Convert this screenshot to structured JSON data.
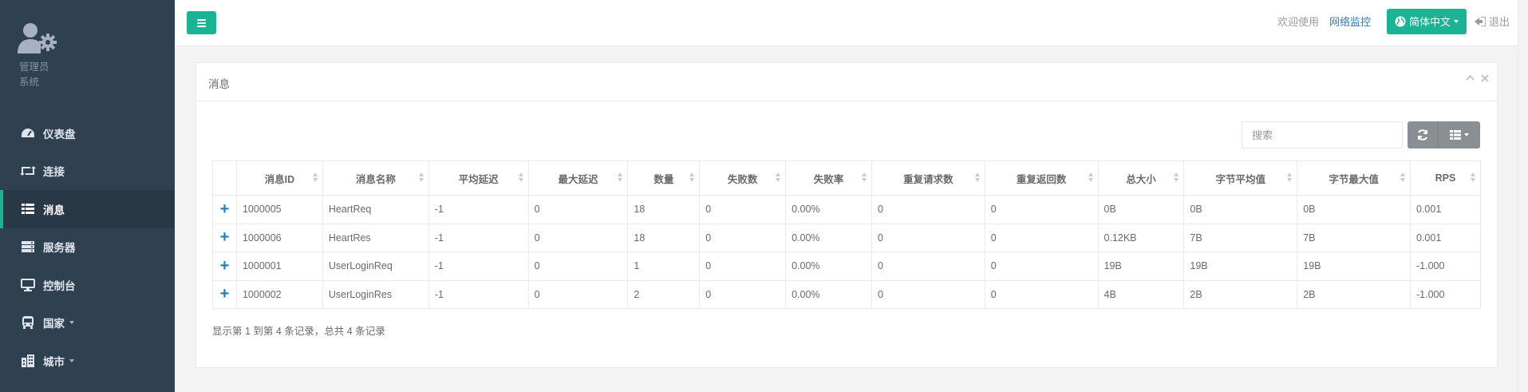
{
  "user": {
    "name": "管理员",
    "role": "系统"
  },
  "nav": [
    {
      "label": "仪表盘",
      "icon": "dashboard-icon",
      "active": false,
      "dropdown": false
    },
    {
      "label": "连接",
      "icon": "retweet-icon",
      "active": false,
      "dropdown": false
    },
    {
      "label": "消息",
      "icon": "table-icon",
      "active": true,
      "dropdown": false
    },
    {
      "label": "服务器",
      "icon": "server-icon",
      "active": false,
      "dropdown": false
    },
    {
      "label": "控制台",
      "icon": "desktop-icon",
      "active": false,
      "dropdown": false
    },
    {
      "label": "国家",
      "icon": "bus-icon",
      "active": false,
      "dropdown": true
    },
    {
      "label": "城市",
      "icon": "building-icon",
      "active": false,
      "dropdown": true
    }
  ],
  "topbar": {
    "welcome": "欢迎使用",
    "monitor_link": "网络监控",
    "language": "简体中文",
    "logout": "退出"
  },
  "panel": {
    "title": "消息",
    "search_placeholder": "搜索"
  },
  "table": {
    "columns": [
      "消息ID",
      "消息名称",
      "平均延迟",
      "最大延迟",
      "数量",
      "失败数",
      "失败率",
      "重复请求数",
      "重复返回数",
      "总大小",
      "字节平均值",
      "字节最大值",
      "RPS"
    ],
    "rows": [
      [
        "1000005",
        "HeartReq",
        "-1",
        "0",
        "18",
        "0",
        "0.00%",
        "0",
        "0",
        "0B",
        "0B",
        "0B",
        "0.001"
      ],
      [
        "1000006",
        "HeartRes",
        "-1",
        "0",
        "18",
        "0",
        "0.00%",
        "0",
        "0",
        "0.12KB",
        "7B",
        "7B",
        "0.001"
      ],
      [
        "1000001",
        "UserLoginReq",
        "-1",
        "0",
        "1",
        "0",
        "0.00%",
        "0",
        "0",
        "19B",
        "19B",
        "19B",
        "-1.000"
      ],
      [
        "1000002",
        "UserLoginRes",
        "-1",
        "0",
        "2",
        "0",
        "0.00%",
        "0",
        "0",
        "4B",
        "2B",
        "2B",
        "-1.000"
      ]
    ],
    "expand_symbol": "+"
  },
  "pagination": {
    "summary": "显示第 1 到第 4 条记录，总共 4 条记录"
  },
  "colors": {
    "sidebar": "#2f4050",
    "accent": "#1ab394",
    "link": "#337ab7",
    "plus": "#1c84c6"
  }
}
